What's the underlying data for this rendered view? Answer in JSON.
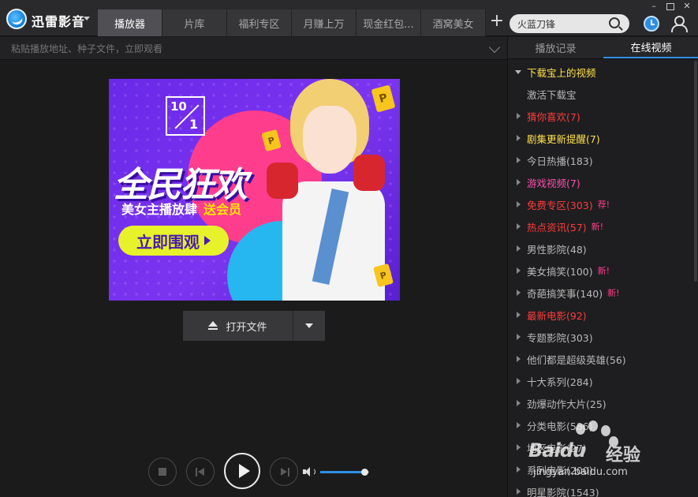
{
  "app": {
    "title": "迅雷影音"
  },
  "tabs": [
    {
      "label": "播放器",
      "active": true
    },
    {
      "label": "片库",
      "active": false
    },
    {
      "label": "福利专区",
      "active": false
    },
    {
      "label": "月赚上万",
      "active": false
    },
    {
      "label": "现金红包...",
      "active": false
    },
    {
      "label": "酒窝美女",
      "active": false
    }
  ],
  "search": {
    "value": "火蓝刀锋"
  },
  "address": {
    "placeholder": "粘贴播放地址、种子文件，立即观看"
  },
  "banner": {
    "date_top": "10",
    "date_bottom": "1",
    "headline": "全民狂欢",
    "subline": "美女主播放肆",
    "subline_highlight": "送会员",
    "cta": "立即围观",
    "ticket_letter": "P"
  },
  "player": {
    "open_file_label": "打开文件",
    "volume": 0.9
  },
  "right_panel": {
    "tabs": [
      {
        "label": "播放记录",
        "active": false
      },
      {
        "label": "在线视频",
        "active": true
      }
    ],
    "items": [
      {
        "label": "下载宝上的视频",
        "color": "#ffe14a",
        "expanded": true,
        "arrow": "down"
      },
      {
        "label": "激活下载宝",
        "color": "#b8b8b8",
        "sub": true
      },
      {
        "label": "猜你喜欢(7)",
        "color": "#ff3b3b",
        "arrow": "right"
      },
      {
        "label": "剧集更新提醒(7)",
        "color": "#ffe14a",
        "arrow": "right"
      },
      {
        "label": "今日热播(183)",
        "color": "#b8b8b8",
        "arrow": "right"
      },
      {
        "label": "游戏视频(7)",
        "color": "#ff4fb0",
        "arrow": "right"
      },
      {
        "label": "免费专区(303)",
        "color": "#ff3b3b",
        "arrow": "right",
        "badge": "荐!"
      },
      {
        "label": "热点资讯(57)",
        "color": "#ff3b3b",
        "arrow": "right",
        "badge": "新!"
      },
      {
        "label": "男性影院(48)",
        "color": "#b8b8b8",
        "arrow": "right"
      },
      {
        "label": "美女搞笑(100)",
        "color": "#b8b8b8",
        "arrow": "right",
        "badge": "新!"
      },
      {
        "label": "奇葩搞笑事(140)",
        "color": "#b8b8b8",
        "arrow": "right",
        "badge": "新!"
      },
      {
        "label": "最新电影(92)",
        "color": "#ff3b3b",
        "arrow": "right"
      },
      {
        "label": "专题影院(303)",
        "color": "#b8b8b8",
        "arrow": "right"
      },
      {
        "label": "他们都是超级英雄(56)",
        "color": "#b8b8b8",
        "arrow": "right"
      },
      {
        "label": "十大系列(284)",
        "color": "#b8b8b8",
        "arrow": "right"
      },
      {
        "label": "劲爆动作大片(25)",
        "color": "#b8b8b8",
        "arrow": "right"
      },
      {
        "label": "分类电影(586)",
        "color": "#b8b8b8",
        "arrow": "right"
      },
      {
        "label": "地区电影(27)",
        "color": "#b8b8b8",
        "arrow": "right"
      },
      {
        "label": "系列电影(200)",
        "color": "#b8b8b8",
        "arrow": "right"
      },
      {
        "label": "明星影院(1543)",
        "color": "#b8b8b8",
        "arrow": "right"
      }
    ]
  },
  "watermark": {
    "brand": "Baidu",
    "text": "经验",
    "url": "jingyan.baidu.com"
  }
}
